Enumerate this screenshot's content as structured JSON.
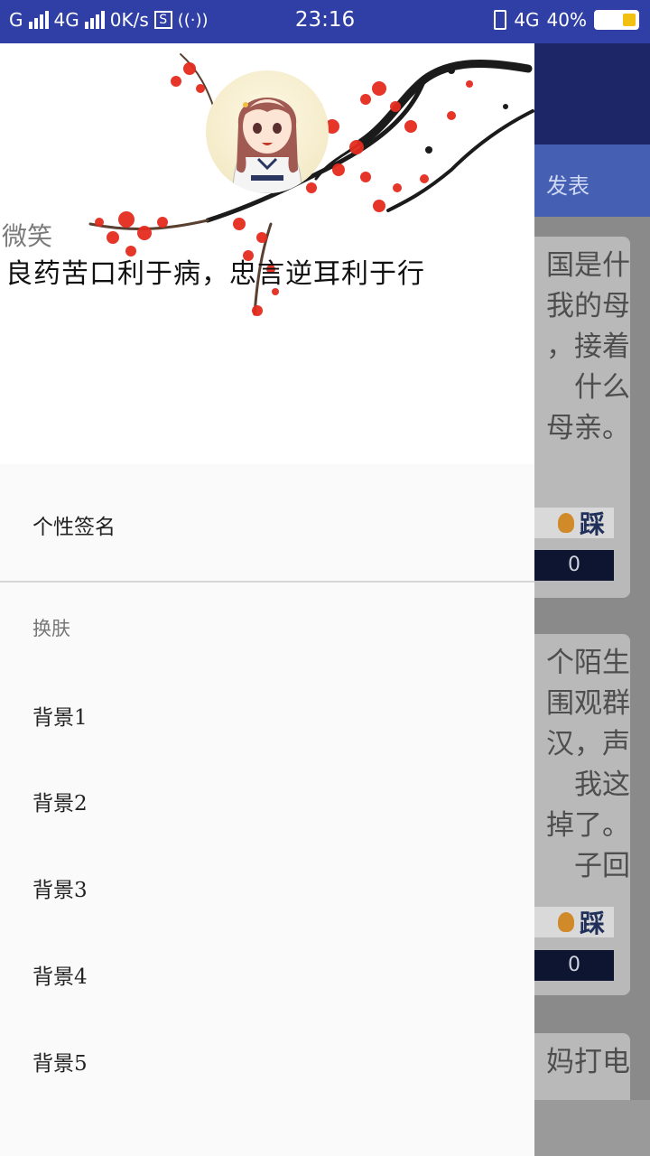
{
  "status_bar": {
    "carrier1": "G",
    "carrier2": "4G",
    "speed": "0K/s",
    "time": "23:16",
    "network": "4G",
    "battery": "40%"
  },
  "background": {
    "tab_label": "发表",
    "cards": [
      {
        "text": "国是什\n我的母\n，接着\n什么\n母亲。",
        "dislike_label": "踩",
        "dislike_count": "0"
      },
      {
        "text": "个陌生\n围观群\n汉，声\n我这\n掉了。\n子回",
        "dislike_label": "踩",
        "dislike_count": "0"
      },
      {
        "text": "妈打电"
      }
    ]
  },
  "drawer": {
    "header": {
      "nickname": "微笑",
      "signature": "良药苦口利于病，忠言逆耳利于行"
    },
    "menu": {
      "signature_item": "个性签名",
      "skin_section": "换肤",
      "backgrounds": [
        "背景1",
        "背景2",
        "背景3",
        "背景4",
        "背景5"
      ]
    }
  },
  "colors": {
    "status_bar": "#2f3fa6",
    "toolbar": "#1d2767",
    "tabs": "#4560b2",
    "drawer_bg": "#fafafa",
    "accent_blossom": "#e52b1e"
  }
}
